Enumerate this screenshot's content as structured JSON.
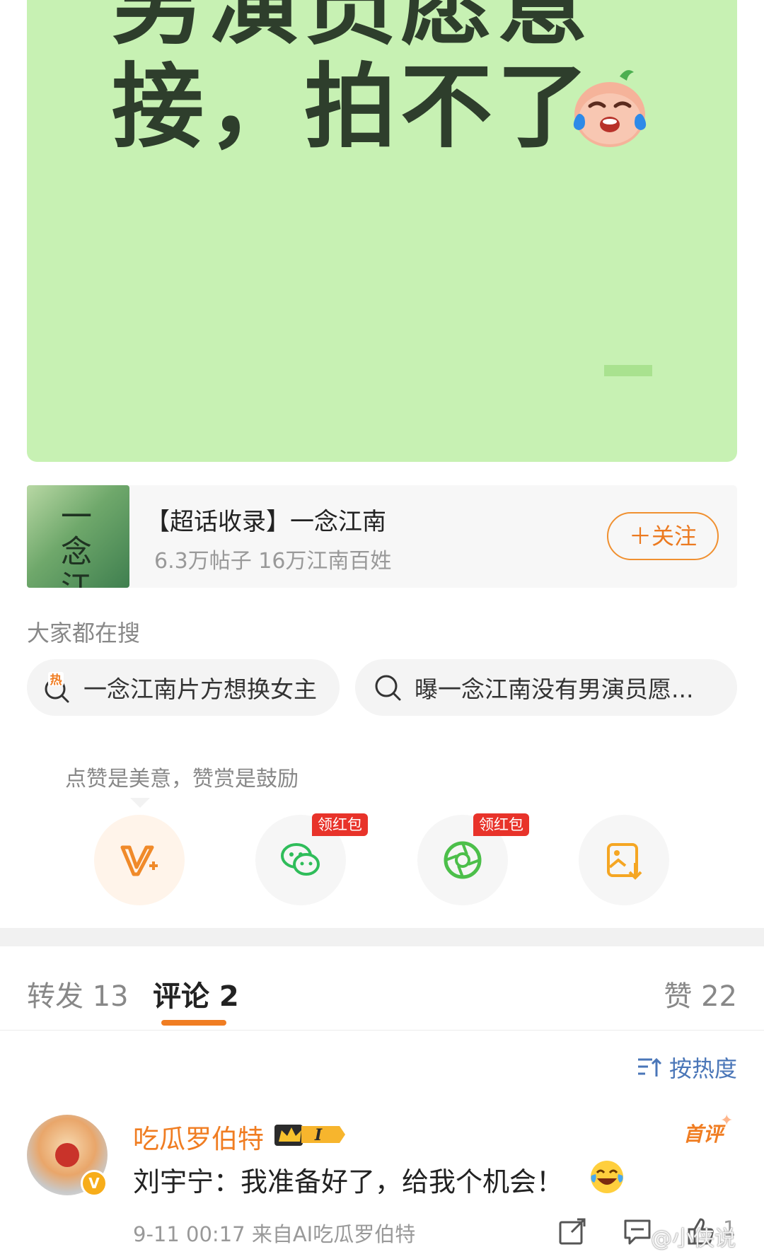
{
  "post": {
    "line1": "男演员愿意",
    "line2": "接，拍不了"
  },
  "topic": {
    "title": "【超话收录】一念江南",
    "stats": "6.3万帖子 16万江南百姓",
    "follow_label": "＋关注",
    "cover_text": "一念江南"
  },
  "search": {
    "heading": "大家都在搜",
    "hot_badge": "热",
    "items": [
      "一念江南片方想换女主",
      "曝一念江南没有男演员愿..."
    ]
  },
  "actions": {
    "tip": "点赞是美意，赞赏是鼓励",
    "badges": [
      "领红包",
      "领红包"
    ]
  },
  "tabs": {
    "repost": "转发 13",
    "comment": "评论 2",
    "like": "赞 22"
  },
  "sort": {
    "label": "按热度"
  },
  "comment": {
    "username": "吃瓜罗伯特",
    "level_badge": "I",
    "first_badge": "首评",
    "text": "刘宇宁：我准备好了，给我个机会！",
    "meta": "9-11 00:17 来自AI吃瓜罗伯特",
    "like_count": "1",
    "verified_mark": "V"
  },
  "watermark": "@小侠说",
  "colors": {
    "accent": "#f07d22",
    "post_bg": "#c7f1b3",
    "link_blue": "#4a76b8",
    "badge_red": "#e8332a"
  },
  "icons": {
    "reward": "v-plus-icon",
    "wechat": "wechat-icon",
    "moments": "moments-shutter-icon",
    "save_image": "save-image-icon"
  }
}
